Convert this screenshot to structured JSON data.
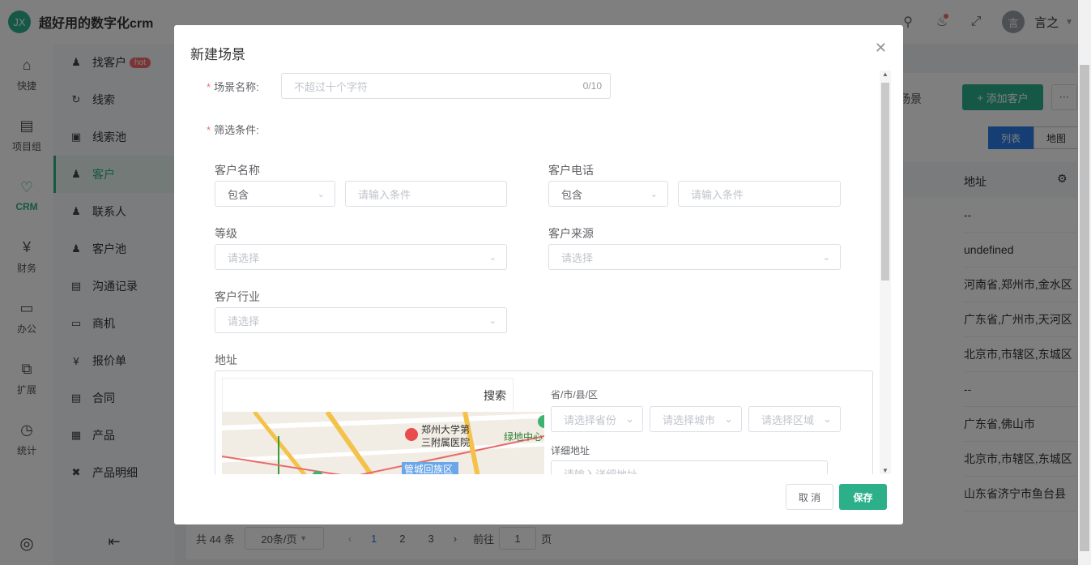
{
  "app": {
    "logo_text": "JX",
    "title": "超好用的数字化crm",
    "user_initial": "言",
    "user_name": "言之"
  },
  "rail": [
    {
      "label": "快捷",
      "icon": "home-icon"
    },
    {
      "label": "项目组",
      "icon": "document-icon"
    },
    {
      "label": "CRM",
      "icon": "heart-icon"
    },
    {
      "label": "财务",
      "icon": "yuan-icon"
    },
    {
      "label": "办公",
      "icon": "monitor-icon"
    },
    {
      "label": "扩展",
      "icon": "extend-icon"
    },
    {
      "label": "统计",
      "icon": "chart-icon"
    }
  ],
  "submenu": [
    {
      "label": "找客户",
      "badge": "hot"
    },
    {
      "label": "线索"
    },
    {
      "label": "线索池"
    },
    {
      "label": "客户"
    },
    {
      "label": "联系人"
    },
    {
      "label": "客户池"
    },
    {
      "label": "沟通记录"
    },
    {
      "label": "商机"
    },
    {
      "label": "报价单"
    },
    {
      "label": "合同"
    },
    {
      "label": "产品"
    },
    {
      "label": "产品明细"
    }
  ],
  "page": {
    "scene_label": "场景",
    "add_customer": "添加客户",
    "view_list": "列表",
    "view_map": "地图",
    "col_address": "地址",
    "rows": [
      "--",
      "undefined",
      "河南省,郑州市,金水区",
      "广东省,广州市,天河区",
      "北京市,市辖区,东城区",
      "--",
      "广东省,佛山市",
      "北京市,市辖区,东城区",
      "山东省济宁市鱼台县"
    ]
  },
  "pager": {
    "total": "共 44 条",
    "page_size": "20条/页",
    "pages": [
      "1",
      "2",
      "3"
    ],
    "goto": "前往",
    "goto_value": "1",
    "page_unit": "页"
  },
  "modal": {
    "title": "新建场景",
    "scene_name_label": "场景名称:",
    "scene_name_placeholder": "不超过十个字符",
    "scene_name_count": "0/10",
    "filter_label": "筛选条件:",
    "customer_name": "客户名称",
    "customer_phone": "客户电话",
    "contains": "包含",
    "enter_condition": "请输入条件",
    "level": "等级",
    "source": "客户来源",
    "industry": "客户行业",
    "please_select": "请选择",
    "address": "地址",
    "search": "搜索",
    "region_label": "省/市/县/区",
    "province": "请选择省份",
    "city": "请选择城市",
    "district": "请选择区域",
    "detail_label": "详细地址",
    "detail_placeholder": "请输入详细地址",
    "map_labels": [
      "郑州大学第",
      "三附属医院",
      "绿地中心",
      "管城回族区"
    ],
    "cancel": "取 消",
    "save": "保存"
  }
}
